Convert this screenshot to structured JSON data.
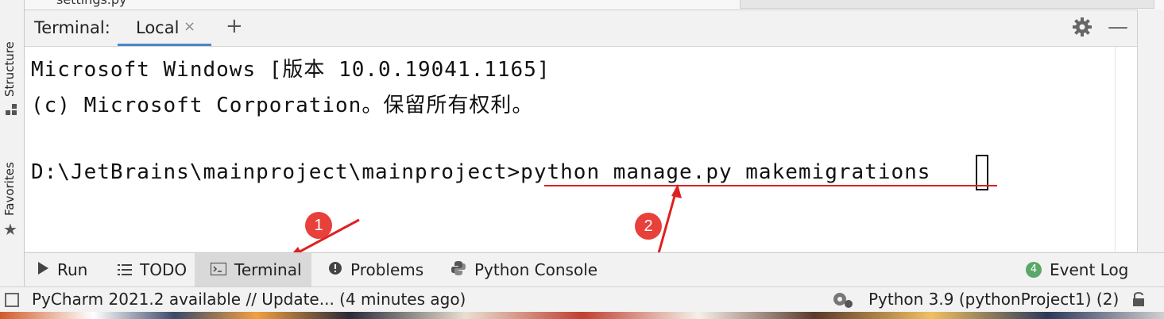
{
  "editor": {
    "tab_label": "settings.py"
  },
  "left_strip": {
    "structure_label": "Structure",
    "favorites_label": "Favorites"
  },
  "terminal": {
    "title": "Terminal:",
    "tab_local": "Local",
    "tab_close_glyph": "×",
    "add_glyph": "+",
    "minimize_glyph": "—",
    "lines": [
      "Microsoft Windows [版本 10.0.19041.1165]",
      "(c) Microsoft Corporation。保留所有权利。",
      "",
      "D:\\JetBrains\\mainproject\\mainproject>python manage.py makemigrations"
    ]
  },
  "annotations": {
    "badge1": "1",
    "badge2": "2",
    "arrow_color": "#e02020"
  },
  "tool_windows": {
    "run": "Run",
    "todo": "TODO",
    "terminal": "Terminal",
    "problems": "Problems",
    "python_console": "Python Console",
    "event_log": "Event Log",
    "event_log_count": "4"
  },
  "status_bar": {
    "update_text": "PyCharm 2021.2 available // Update... (4 minutes ago)",
    "interpreter": "Python 3.9 (pythonProject1) (2)"
  },
  "colors": {
    "accent": "#4a86c7",
    "badge": "#e8403a",
    "event_badge": "#59a869"
  }
}
